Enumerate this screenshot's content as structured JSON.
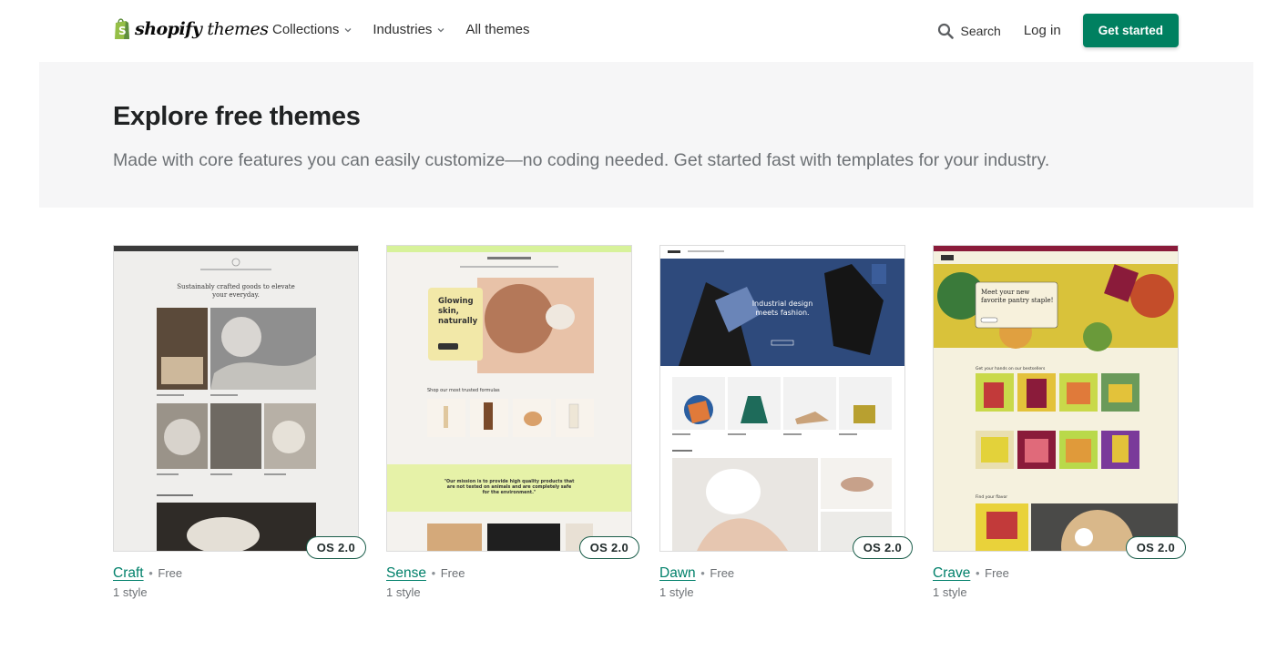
{
  "header": {
    "brand_main": "shopify",
    "brand_sub": "themes",
    "nav": [
      {
        "label": "Collections",
        "has_dropdown": true
      },
      {
        "label": "Industries",
        "has_dropdown": true
      },
      {
        "label": "All themes",
        "has_dropdown": false
      }
    ],
    "search_label": "Search",
    "login_label": "Log in",
    "cta_label": "Get started"
  },
  "hero": {
    "title": "Explore free themes",
    "subtitle": "Made with core features you can easily customize—no coding needed. Get started fast with templates for your industry."
  },
  "themes": [
    {
      "name": "Craft",
      "price": "Free",
      "styles": "1 style",
      "badge": "OS 2.0"
    },
    {
      "name": "Sense",
      "price": "Free",
      "styles": "1 style",
      "badge": "OS 2.0"
    },
    {
      "name": "Dawn",
      "price": "Free",
      "styles": "1 style",
      "badge": "OS 2.0"
    },
    {
      "name": "Crave",
      "price": "Free",
      "styles": "1 style",
      "badge": "OS 2.0"
    }
  ],
  "previews": {
    "craft_headline_1": "Sustainably crafted goods to elevate",
    "craft_headline_2": "your everyday.",
    "sense_headline_1": "Glowing",
    "sense_headline_2": "skin,",
    "sense_headline_3": "naturally",
    "sense_section": "Shop our most trusted formulas",
    "sense_quote_1": "\"Our mission is to provide high quality products that",
    "sense_quote_2": "are not tested on animals and are completely safe",
    "sense_quote_3": "for the environment.\"",
    "dawn_headline_1": "Industrial design",
    "dawn_headline_2": "meets fashion.",
    "crave_headline_1": "Meet your new",
    "crave_headline_2": "favorite pantry staple!",
    "crave_section": "Get your hands on our bestsellers",
    "crave_section_2": "Find your flavor"
  },
  "colors": {
    "brand_green": "#008060",
    "link_green": "#00806a",
    "hero_bg": "#f6f6f7",
    "badge_border": "#1b5e4b"
  },
  "icons": {
    "search": "search-icon",
    "chevron": "chevron-down-icon",
    "logo": "shopify-bag-icon"
  }
}
